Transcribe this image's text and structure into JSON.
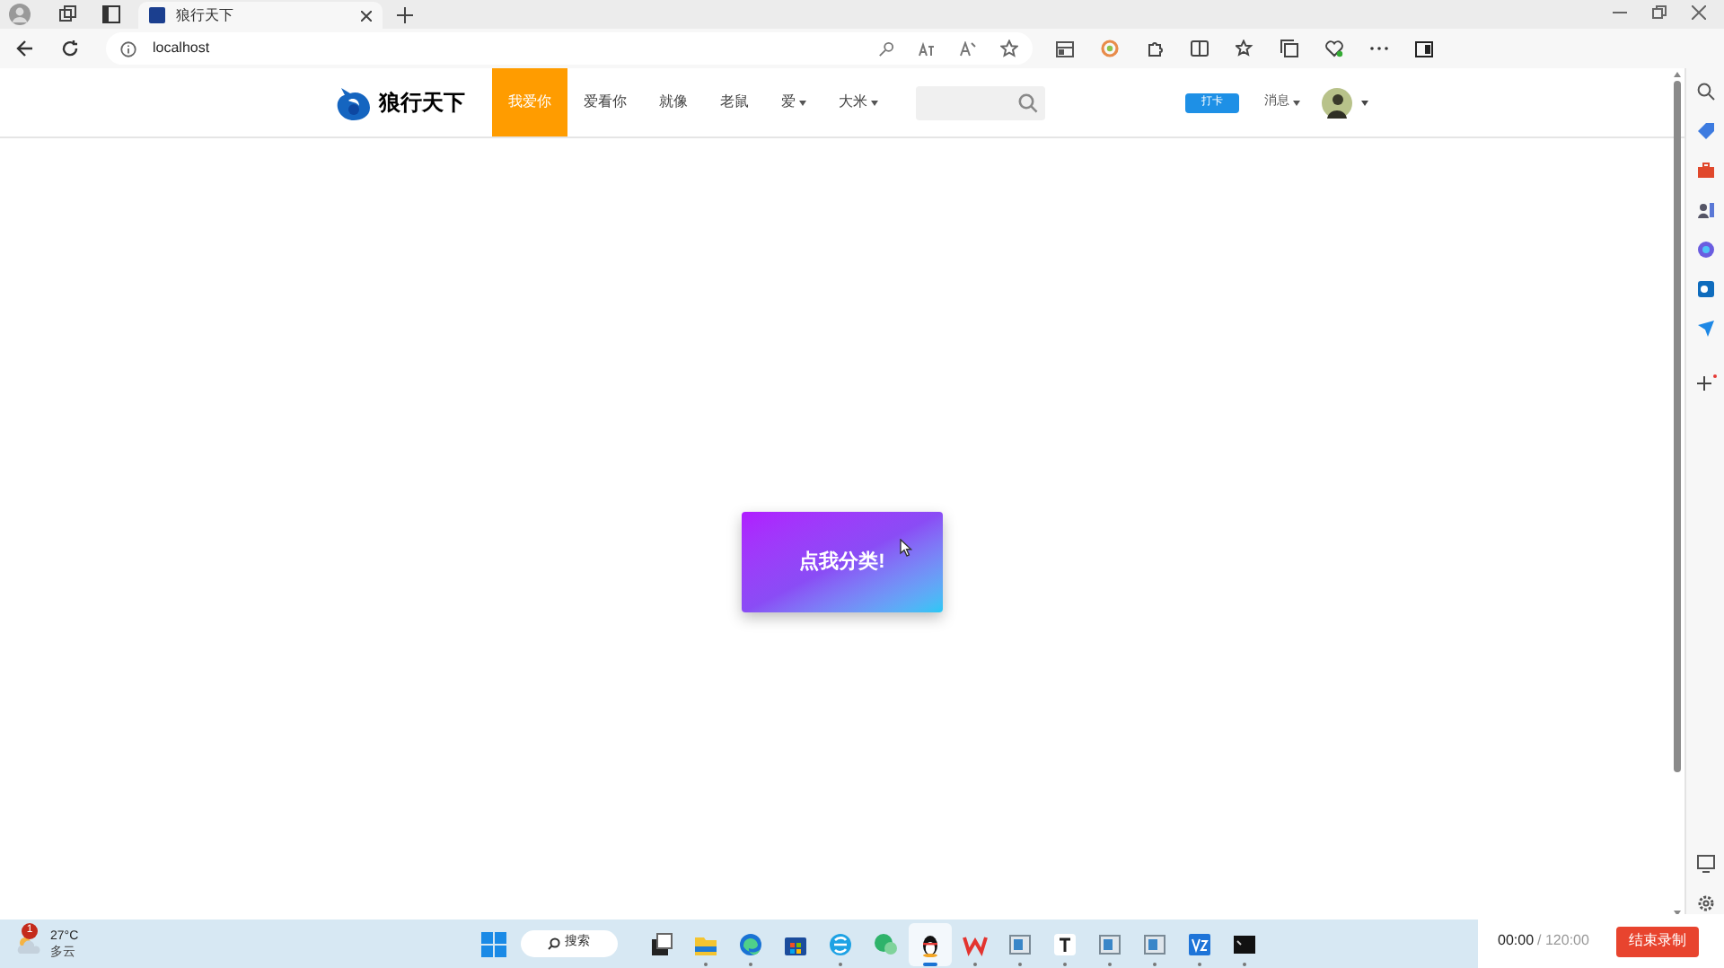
{
  "browser": {
    "tab_title": "狼行天下",
    "url": "localhost"
  },
  "nav": {
    "logo": "狼行天下",
    "items": [
      {
        "label": "我爱你",
        "selected": true,
        "dropdown": false
      },
      {
        "label": "爱看你",
        "selected": false,
        "dropdown": false
      },
      {
        "label": "就像",
        "selected": false,
        "dropdown": false
      },
      {
        "label": "老鼠",
        "selected": false,
        "dropdown": false
      },
      {
        "label": "爱",
        "selected": false,
        "dropdown": true
      },
      {
        "label": "大米",
        "selected": false,
        "dropdown": true
      }
    ],
    "checkin_button": "打卡",
    "messages": "消息"
  },
  "main_button": "点我分类!",
  "taskbar": {
    "weather": {
      "temperature": "27°C",
      "condition": "多云",
      "badge": "1"
    },
    "search": "搜索",
    "apps": [
      {
        "kind": "files",
        "selected": false,
        "running": false
      },
      {
        "kind": "folder",
        "selected": false,
        "running": true
      },
      {
        "kind": "edge",
        "selected": false,
        "running": true
      },
      {
        "kind": "store",
        "selected": false,
        "running": false
      },
      {
        "kind": "ie",
        "selected": false,
        "running": true
      },
      {
        "kind": "chat",
        "selected": false,
        "running": false
      },
      {
        "kind": "penguin",
        "selected": true,
        "running": true
      },
      {
        "kind": "office",
        "selected": false,
        "running": true
      },
      {
        "kind": "window",
        "selected": false,
        "running": true
      },
      {
        "kind": "text",
        "selected": false,
        "running": true
      },
      {
        "kind": "window",
        "selected": false,
        "running": true
      },
      {
        "kind": "window",
        "selected": false,
        "running": true
      },
      {
        "kind": "vs",
        "selected": false,
        "running": true
      },
      {
        "kind": "terminal",
        "selected": false,
        "running": true
      }
    ]
  },
  "recording": {
    "elapsed": "00:00",
    "total": "/ 120:00",
    "stop_button": "结束录制"
  }
}
